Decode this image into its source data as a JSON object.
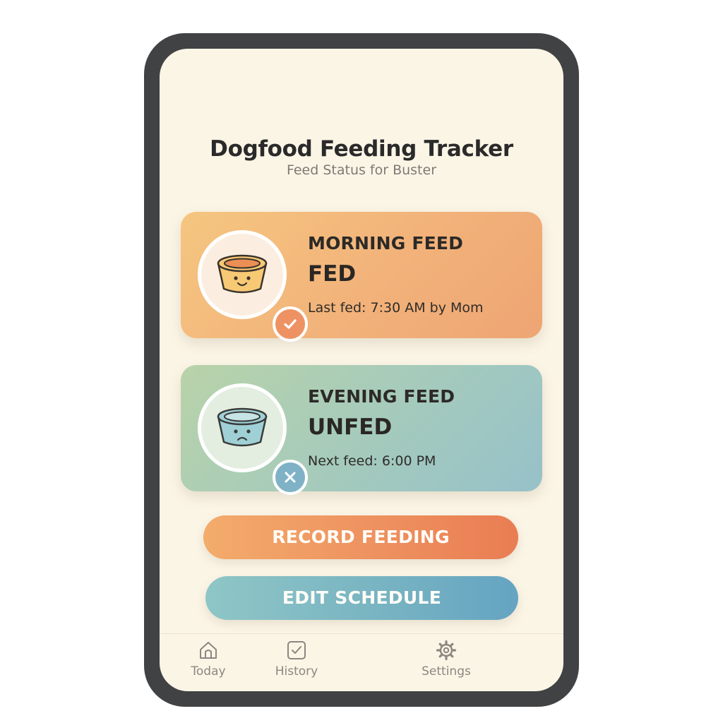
{
  "app": {
    "title": "Dogfood Feeding Tracker",
    "subtitle": "Feed Status for Buster"
  },
  "cards": [
    {
      "label": "MORNING FEED",
      "status": "FED",
      "detail": "Last fed: 7:30 AM by Mom",
      "bowl_icon": "happy-bowl-icon",
      "badge_icon": "checkmark-icon",
      "color": "#f2b27a"
    },
    {
      "label": "EVENING FEED",
      "status": "UNFED",
      "detail": "Next feed: 6:00 PM",
      "bowl_icon": "sad-bowl-icon",
      "badge_icon": "cross-icon",
      "color": "#a6cbbb"
    }
  ],
  "buttons": {
    "record": "RECORD FEEDING",
    "edit": "EDIT SCHEDULE"
  },
  "nav": [
    {
      "label": "Today",
      "icon": "home-icon"
    },
    {
      "label": "History",
      "icon": "checkbox-icon"
    },
    {
      "label": "Settings",
      "icon": "gear-icon"
    }
  ],
  "colors": {
    "frame": "#414244",
    "screen_bg": "#fbf5e6",
    "record_accent": "#ee9160",
    "edit_accent": "#78b4c2"
  }
}
